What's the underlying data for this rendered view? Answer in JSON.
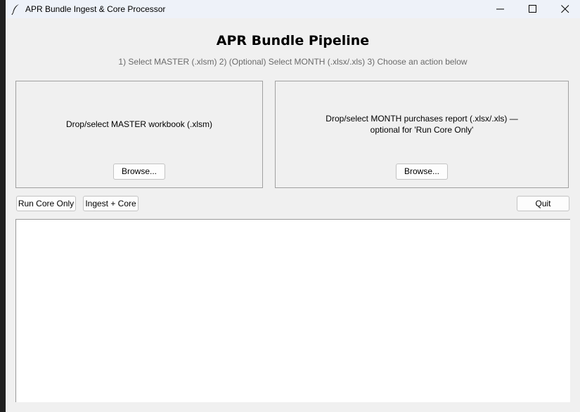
{
  "window": {
    "title": "APR Bundle Ingest & Core Processor"
  },
  "header": {
    "title": "APR Bundle Pipeline",
    "instructions": "1) Select MASTER (.xlsm)   2) (Optional) Select MONTH (.xlsx/.xls)   3) Choose an action below"
  },
  "master_drop": {
    "text": "Drop/select MASTER workbook (.xlsm)",
    "browse_label": "Browse..."
  },
  "month_drop": {
    "text_line1": "Drop/select MONTH purchases report (.xlsx/.xls) —",
    "text_line2": "optional for 'Run Core Only'",
    "browse_label": "Browse..."
  },
  "actions": {
    "run_core_label": "Run Core Only",
    "ingest_core_label": "Ingest + Core",
    "quit_label": "Quit"
  },
  "log": {
    "content": ""
  },
  "icons": {
    "app": "feather-icon",
    "minimize": "minimize-icon",
    "maximize": "maximize-icon",
    "close": "close-icon"
  }
}
